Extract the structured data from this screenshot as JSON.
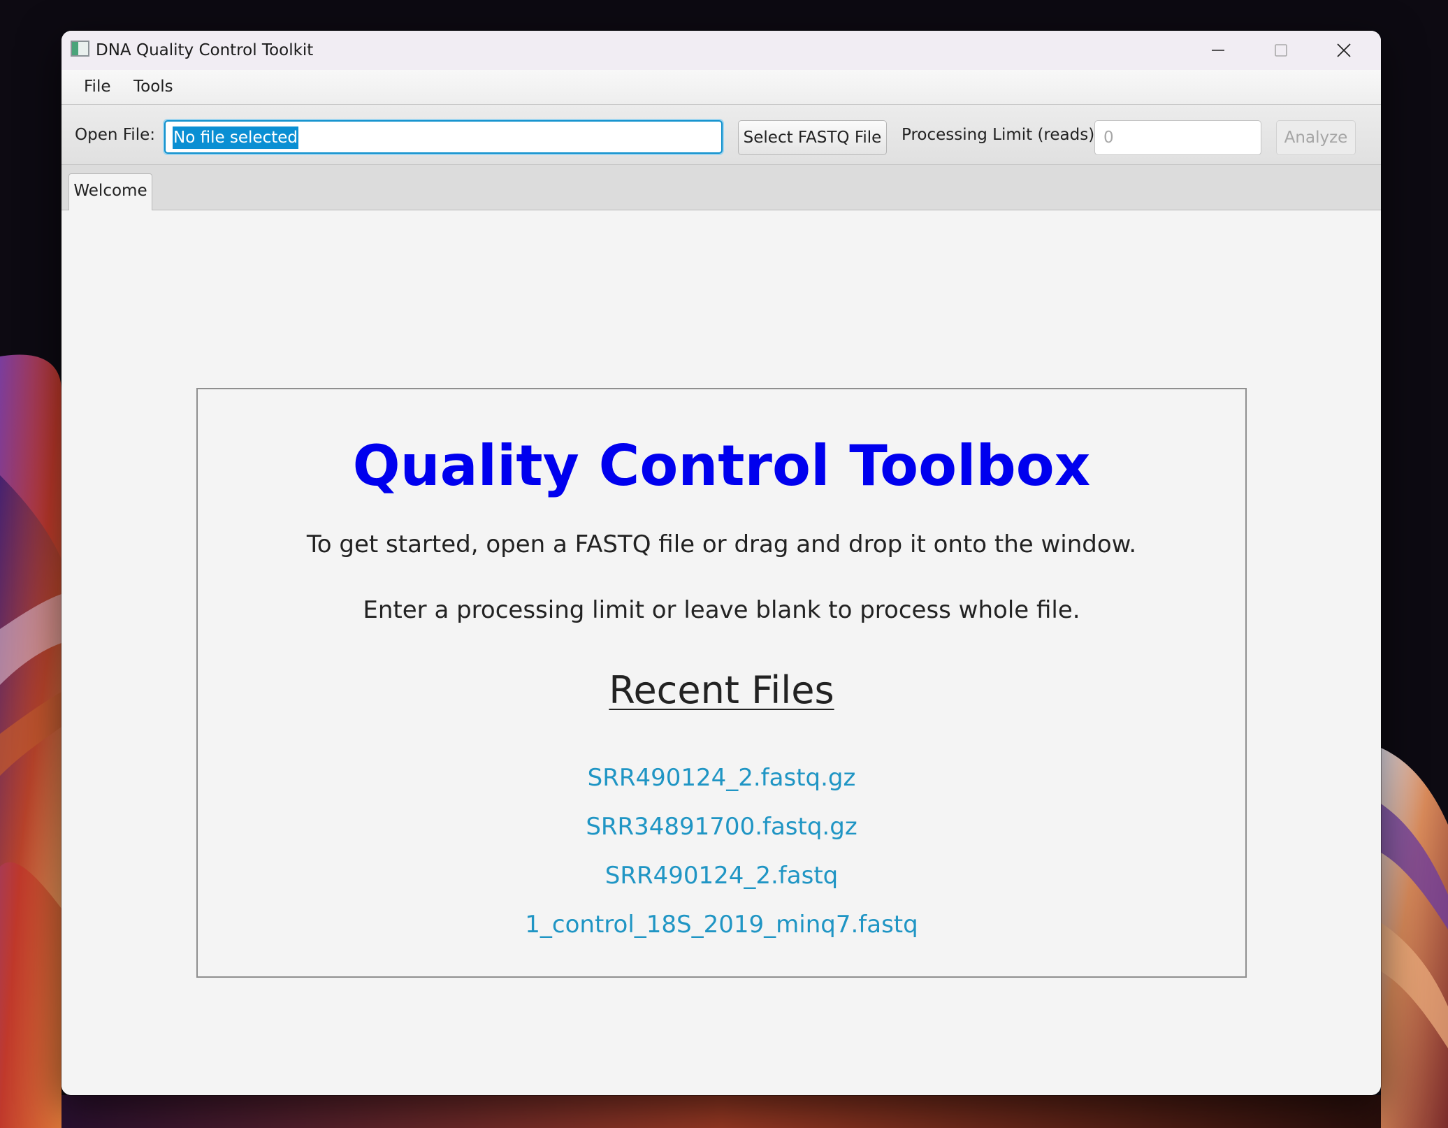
{
  "window": {
    "title": "DNA Quality Control Toolkit"
  },
  "menubar": {
    "items": [
      {
        "label": "File"
      },
      {
        "label": "Tools"
      }
    ]
  },
  "toolbar": {
    "open_file_label": "Open File:",
    "file_field_value": "No file selected",
    "select_button_label": "Select FASTQ File",
    "limit_label": "Processing Limit (reads):",
    "limit_placeholder": "0",
    "analyze_button_label": "Analyze"
  },
  "tabs": [
    {
      "label": "Welcome",
      "selected": true
    }
  ],
  "welcome": {
    "title": "Quality Control Toolbox",
    "line1": "To get started, open a FASTQ file or drag and drop it onto the window.",
    "line2": "Enter a processing limit or leave blank to process whole file.",
    "recent_heading": "Recent Files",
    "recent_files": [
      "SRR490124_2.fastq.gz",
      "SRR34891700.fastq.gz",
      "SRR490124_2.fastq",
      "1_control_18S_2019_minq7.fastq"
    ]
  },
  "colors": {
    "title_blue": "#0000ee",
    "link_blue": "#1f95c4",
    "focus_blue": "#0d8fcc",
    "selection_blue": "#0a8fd3"
  },
  "icons": {
    "app": "app-window-icon",
    "minimize": "minimize-icon",
    "maximize": "maximize-icon",
    "close": "close-icon"
  }
}
